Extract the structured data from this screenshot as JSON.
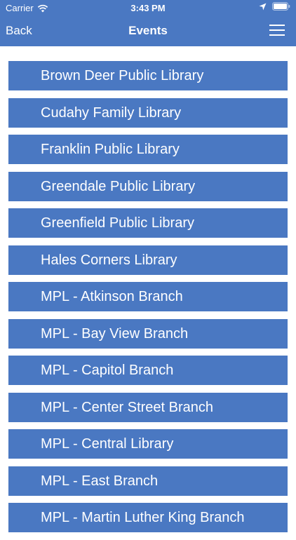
{
  "status_bar": {
    "carrier": "Carrier",
    "time": "3:43 PM"
  },
  "nav": {
    "back_label": "Back",
    "title": "Events",
    "menu_icon": "hamburger-menu-icon"
  },
  "libraries": [
    "Brown Deer Public Library",
    "Cudahy Family Library",
    "Franklin Public Library",
    "Greendale Public Library",
    "Greenfield Public Library",
    "Hales Corners Library",
    "MPL - Atkinson Branch",
    "MPL - Bay View Branch",
    "MPL - Capitol Branch",
    "MPL - Center Street Branch",
    "MPL - Central Library",
    "MPL - East Branch",
    "MPL - Martin Luther King Branch"
  ],
  "colors": {
    "accent": "#4a78c2",
    "background": "#ffffff"
  }
}
